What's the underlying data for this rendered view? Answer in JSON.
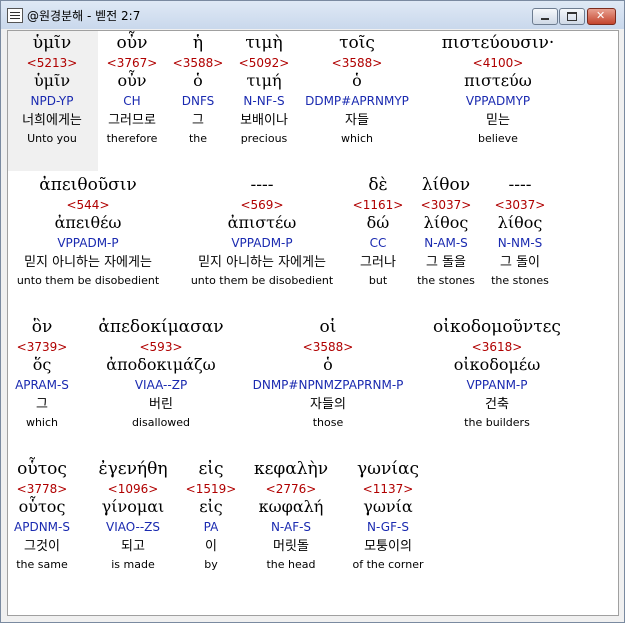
{
  "window": {
    "title": "@원경분해 - 벧전 2:7",
    "icon": "document-icon",
    "buttons": [
      "minimize-icon",
      "maximize-icon",
      "close-icon"
    ]
  },
  "rows": [
    {
      "words": [
        {
          "greek": "ὑμῖν",
          "strong": "<5213>",
          "lemma": "ὑμῖν",
          "parse": "NPD-YP",
          "korean": "너희에게는",
          "english": "Unto you"
        },
        {
          "greek": "οὖν",
          "strong": "<3767>",
          "lemma": "οὖν",
          "parse": "CH",
          "korean": "그러므로",
          "english": "therefore"
        },
        {
          "greek": "ἡ",
          "strong": "<3588>",
          "lemma": "ὁ",
          "parse": "DNFS",
          "korean": "그",
          "english": "the"
        },
        {
          "greek": "τιμὴ",
          "strong": "<5092>",
          "lemma": "τιμή",
          "parse": "N-NF-S",
          "korean": "보배이나",
          "english": "precious"
        },
        {
          "greek": "τοῖς",
          "strong": "<3588>",
          "lemma": "ὁ",
          "parse": "DDMP#APRNMYP",
          "korean": "자들",
          "english": "which"
        },
        {
          "greek": "πιστεύουσιν·",
          "strong": "<4100>",
          "lemma": "πιστεύω",
          "parse": "VPPADMYP",
          "korean": "믿는",
          "english": "believe"
        }
      ]
    },
    {
      "words": [
        {
          "greek": "ἀπειθοῦσιν",
          "strong": "<544>",
          "lemma": "ἀπειθέω",
          "parse": "VPPADM-P",
          "korean": "믿지 아니하는 자에게는",
          "english": "unto them be disobedient"
        },
        {
          "greek": "----",
          "strong": "<569>",
          "lemma": "ἀπιστέω",
          "parse": "VPPADM-P",
          "korean": "믿지 아니하는 자에게는",
          "english": "unto them be disobedient"
        },
        {
          "greek": "δὲ",
          "strong": "<1161>",
          "lemma": "δώ",
          "parse": "CC",
          "korean": "그러나",
          "english": "but"
        },
        {
          "greek": "λίθον",
          "strong": "<3037>",
          "lemma": "λίθος",
          "parse": "N-AM-S",
          "korean": "그 돌을",
          "english": "the stones"
        },
        {
          "greek": "----",
          "strong": "<3037>",
          "lemma": "λίθος",
          "parse": "N-NM-S",
          "korean": "그 돌이",
          "english": "the stones"
        }
      ]
    },
    {
      "words": [
        {
          "greek": "ὃν",
          "strong": "<3739>",
          "lemma": "ὅς",
          "parse": "APRAM-S",
          "korean": "그",
          "english": "which"
        },
        {
          "greek": "ἀπεδοκίμασαν",
          "strong": "<593>",
          "lemma": "ἀποδοκιμάζω",
          "parse": "VIAA--ZP",
          "korean": "버린",
          "english": "disallowed"
        },
        {
          "greek": "οἱ",
          "strong": "<3588>",
          "lemma": "ὁ",
          "parse": "DNMP#NPNMZPAPRNM-P",
          "korean": "자들의",
          "english": "those"
        },
        {
          "greek": "οἰκοδομοῦντες",
          "strong": "<3618>",
          "lemma": "οἰκοδομέω",
          "parse": "VPPANM-P",
          "korean": "건축",
          "english": "the builders"
        }
      ]
    },
    {
      "words": [
        {
          "greek": "οὗτος",
          "strong": "<3778>",
          "lemma": "οὗτος",
          "parse": "APDNM-S",
          "korean": "그것이",
          "english": "the same"
        },
        {
          "greek": "ἐγενήθη",
          "strong": "<1096>",
          "lemma": "γίνομαι",
          "parse": "VIAO--ZS",
          "korean": "되고",
          "english": "is made"
        },
        {
          "greek": "εἰς",
          "strong": "<1519>",
          "lemma": "εἰς",
          "parse": "PA",
          "korean": "이",
          "english": "by"
        },
        {
          "greek": "κεφαλὴν",
          "strong": "<2776>",
          "lemma": "κωφαλή",
          "parse": "N-AF-S",
          "korean": "머릿돌",
          "english": "the head"
        },
        {
          "greek": "γωνίας",
          "strong": "<1137>",
          "lemma": "γωνία",
          "parse": "N-GF-S",
          "korean": "모퉁이의",
          "english": "of the corner"
        }
      ]
    }
  ]
}
